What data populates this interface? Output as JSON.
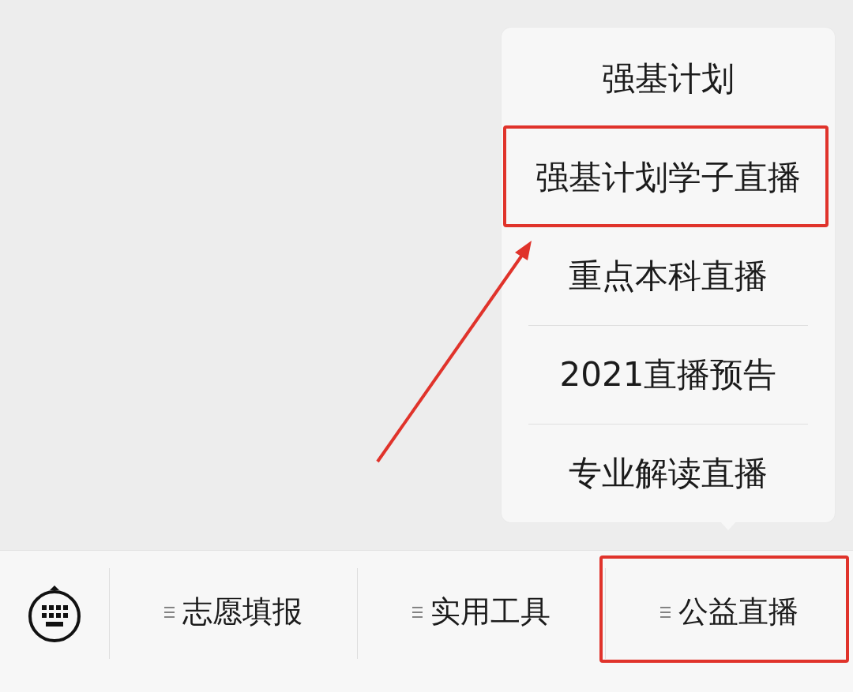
{
  "popup_menu": {
    "items": [
      {
        "label": "强基计划",
        "highlighted": false
      },
      {
        "label": "强基计划学子直播",
        "highlighted": true
      },
      {
        "label": "重点本科直播",
        "highlighted": false
      },
      {
        "label": "2021直播预告",
        "highlighted": false
      },
      {
        "label": "专业解读直播",
        "highlighted": false
      }
    ]
  },
  "menu_bar": {
    "items": [
      {
        "label": "志愿填报",
        "highlighted": false
      },
      {
        "label": "实用工具",
        "highlighted": false
      },
      {
        "label": "公益直播",
        "highlighted": true
      }
    ]
  },
  "annotations": [
    {
      "kind": "arrow"
    }
  ]
}
